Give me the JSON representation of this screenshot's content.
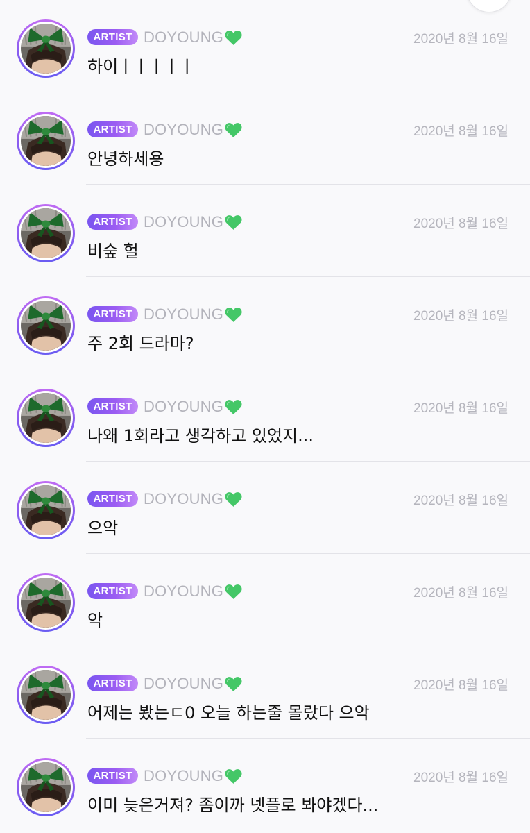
{
  "badge_label": "ARTIST",
  "icons": {
    "avatar": "artist-avatar-green-ribbon",
    "heart": "green-heart-icon"
  },
  "colors": {
    "badge_start": "#7a56f0",
    "badge_end": "#c28af8",
    "heart": "#44c767",
    "ring": "#8a5df0"
  },
  "messages": [
    {
      "name": "DOYOUNG",
      "date": "2020년 8월 16일",
      "text": "하이ㅣㅣㅣㅣㅣ"
    },
    {
      "name": "DOYOUNG",
      "date": "2020년 8월 16일",
      "text": "안녕하세용"
    },
    {
      "name": "DOYOUNG",
      "date": "2020년 8월 16일",
      "text": "비숲 헐"
    },
    {
      "name": "DOYOUNG",
      "date": "2020년 8월 16일",
      "text": "주 2회 드라마?"
    },
    {
      "name": "DOYOUNG",
      "date": "2020년 8월 16일",
      "text": "나왜 1회라고 생각하고 있었지..."
    },
    {
      "name": "DOYOUNG",
      "date": "2020년 8월 16일",
      "text": "으악"
    },
    {
      "name": "DOYOUNG",
      "date": "2020년 8월 16일",
      "text": "악"
    },
    {
      "name": "DOYOUNG",
      "date": "2020년 8월 16일",
      "text": "어제는 봤는ㄷ0 오늘 하는줄 몰랐다 으악"
    },
    {
      "name": "DOYOUNG",
      "date": "2020년 8월 16일",
      "text": "이미 늦은거져? 좀이까 넷플로 봐야겠다..."
    }
  ]
}
